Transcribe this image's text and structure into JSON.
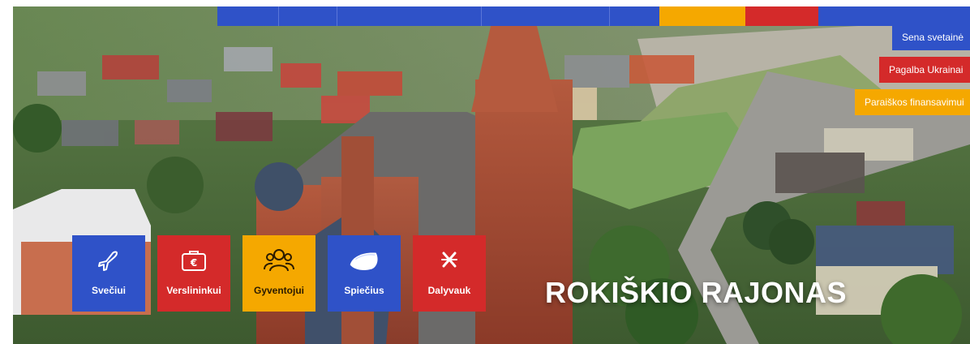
{
  "topbar": {
    "segments": [
      "#2f52c8",
      "#2f52c8",
      "#2f52c8",
      "#2f52c8",
      "#2f52c8",
      "#f5a800",
      "#d42a2a",
      "#2f52c8"
    ]
  },
  "side_links": [
    {
      "label": "Sena svetainė",
      "color": "#2f52c8"
    },
    {
      "label": "Pagalba Ukrainai",
      "color": "#d42a2a"
    },
    {
      "label": "Paraiškos finansavimui",
      "color": "#f5a800"
    }
  ],
  "tiles": [
    {
      "label": "Svečiui",
      "icon": "airplane-icon",
      "color": "#2f52c8"
    },
    {
      "label": "Verslininkui",
      "icon": "briefcase-euro-icon",
      "color": "#d42a2a"
    },
    {
      "label": "Gyventojui",
      "icon": "people-icon",
      "color": "#f5a800"
    },
    {
      "label": "Spiečius",
      "icon": "spiecius-logo-icon",
      "color": "#2f52c8"
    },
    {
      "label": "Dalyvauk",
      "icon": "participate-icon",
      "color": "#d42a2a"
    }
  ],
  "hero": {
    "title": "ROKIŠKIO RAJONAS"
  }
}
